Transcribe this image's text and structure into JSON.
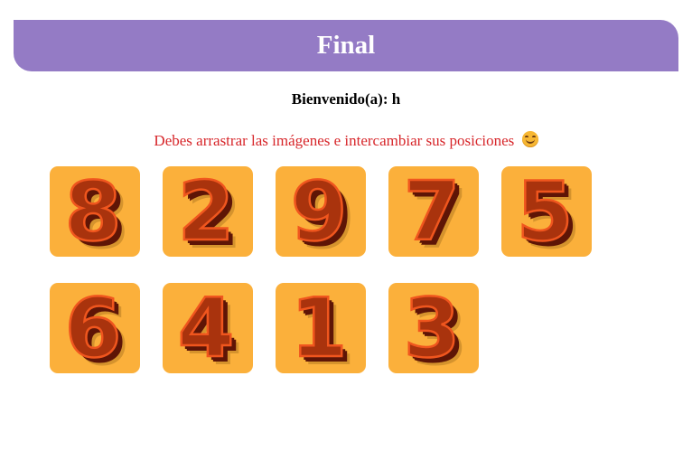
{
  "header": {
    "title": "Final"
  },
  "welcome": {
    "text": "Bienvenido(a): h"
  },
  "instruction": {
    "text": "Debes arrastrar las imágenes e intercambiar sus posiciones"
  },
  "colors": {
    "header_bg": "#947bc5",
    "instruction_text": "#d7262a",
    "tile_bg": "#fbb03b",
    "digit_face": "#a9330d"
  },
  "tiles": [
    {
      "digit": "8"
    },
    {
      "digit": "2"
    },
    {
      "digit": "9"
    },
    {
      "digit": "7"
    },
    {
      "digit": "5"
    },
    {
      "digit": "6"
    },
    {
      "digit": "4"
    },
    {
      "digit": "1"
    },
    {
      "digit": "3"
    }
  ]
}
